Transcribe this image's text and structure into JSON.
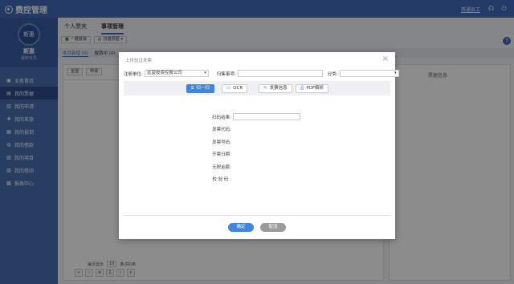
{
  "app": {
    "title": "费控管理",
    "user": "西通员工"
  },
  "profile": {
    "avatar_text": "斯惠",
    "name": "斯惠",
    "subtitle": "报账专员"
  },
  "sidebar": {
    "items": [
      {
        "label": "业务首页",
        "icon": "home-icon",
        "glyph": "▣"
      },
      {
        "label": "我的票据",
        "icon": "receipt-icon",
        "glyph": "▤"
      },
      {
        "label": "我的申请",
        "icon": "apply-icon",
        "glyph": "▥"
      },
      {
        "label": "我的差旅",
        "icon": "travel-icon",
        "glyph": "✚"
      },
      {
        "label": "我的报销",
        "icon": "expense-icon",
        "glyph": "▦"
      },
      {
        "label": "我的借款",
        "icon": "loan-icon",
        "glyph": "◍"
      },
      {
        "label": "我的项目",
        "icon": "project-icon",
        "glyph": "▧"
      },
      {
        "label": "我的借阅",
        "icon": "borrow-icon",
        "glyph": "▨"
      },
      {
        "label": "报表中心",
        "icon": "report-icon",
        "glyph": "▩"
      }
    ],
    "active_index": 1
  },
  "main": {
    "tabs": [
      "个人票夹",
      "事项管理"
    ],
    "toolbar": {
      "btn1": "一键报销",
      "btn2": "扫描票据"
    },
    "subtabs": [
      "本月新增 (0)",
      "报销中 (0)"
    ],
    "panel_toolbar": {
      "btn1": "全选",
      "btn2": "申请"
    },
    "right_label": "票据信息",
    "pager": {
      "prefix": "每页显示",
      "size": "10",
      "suffix": "条/共0条",
      "page": "1"
    }
  },
  "modal": {
    "title": "上传验证发票",
    "company_label": "注册单位:",
    "company_value": "远望投资控股公司",
    "matter_label": "归集事项:",
    "category_label": "分类:",
    "modes": [
      {
        "label": "扫一扫",
        "icon": "scan-icon",
        "glyph": "⌸"
      },
      {
        "label": "OCR",
        "icon": "ocr-icon",
        "glyph": "▭"
      },
      {
        "label": "发票信息",
        "icon": "invoice-info-icon",
        "glyph": "✎"
      },
      {
        "label": "PDF解析",
        "icon": "pdf-icon",
        "glyph": "⎙"
      }
    ],
    "fields": [
      "扫码结果:",
      "发票代码:",
      "发票号码:",
      "开票日期:",
      "无税金额:",
      "校 验 码 :"
    ],
    "ok_label": "确定",
    "cancel_label": "取消"
  },
  "colors": {
    "header": "#3f6bb8",
    "sidebar": "#4a6fb3",
    "primary": "#3f86e0"
  }
}
